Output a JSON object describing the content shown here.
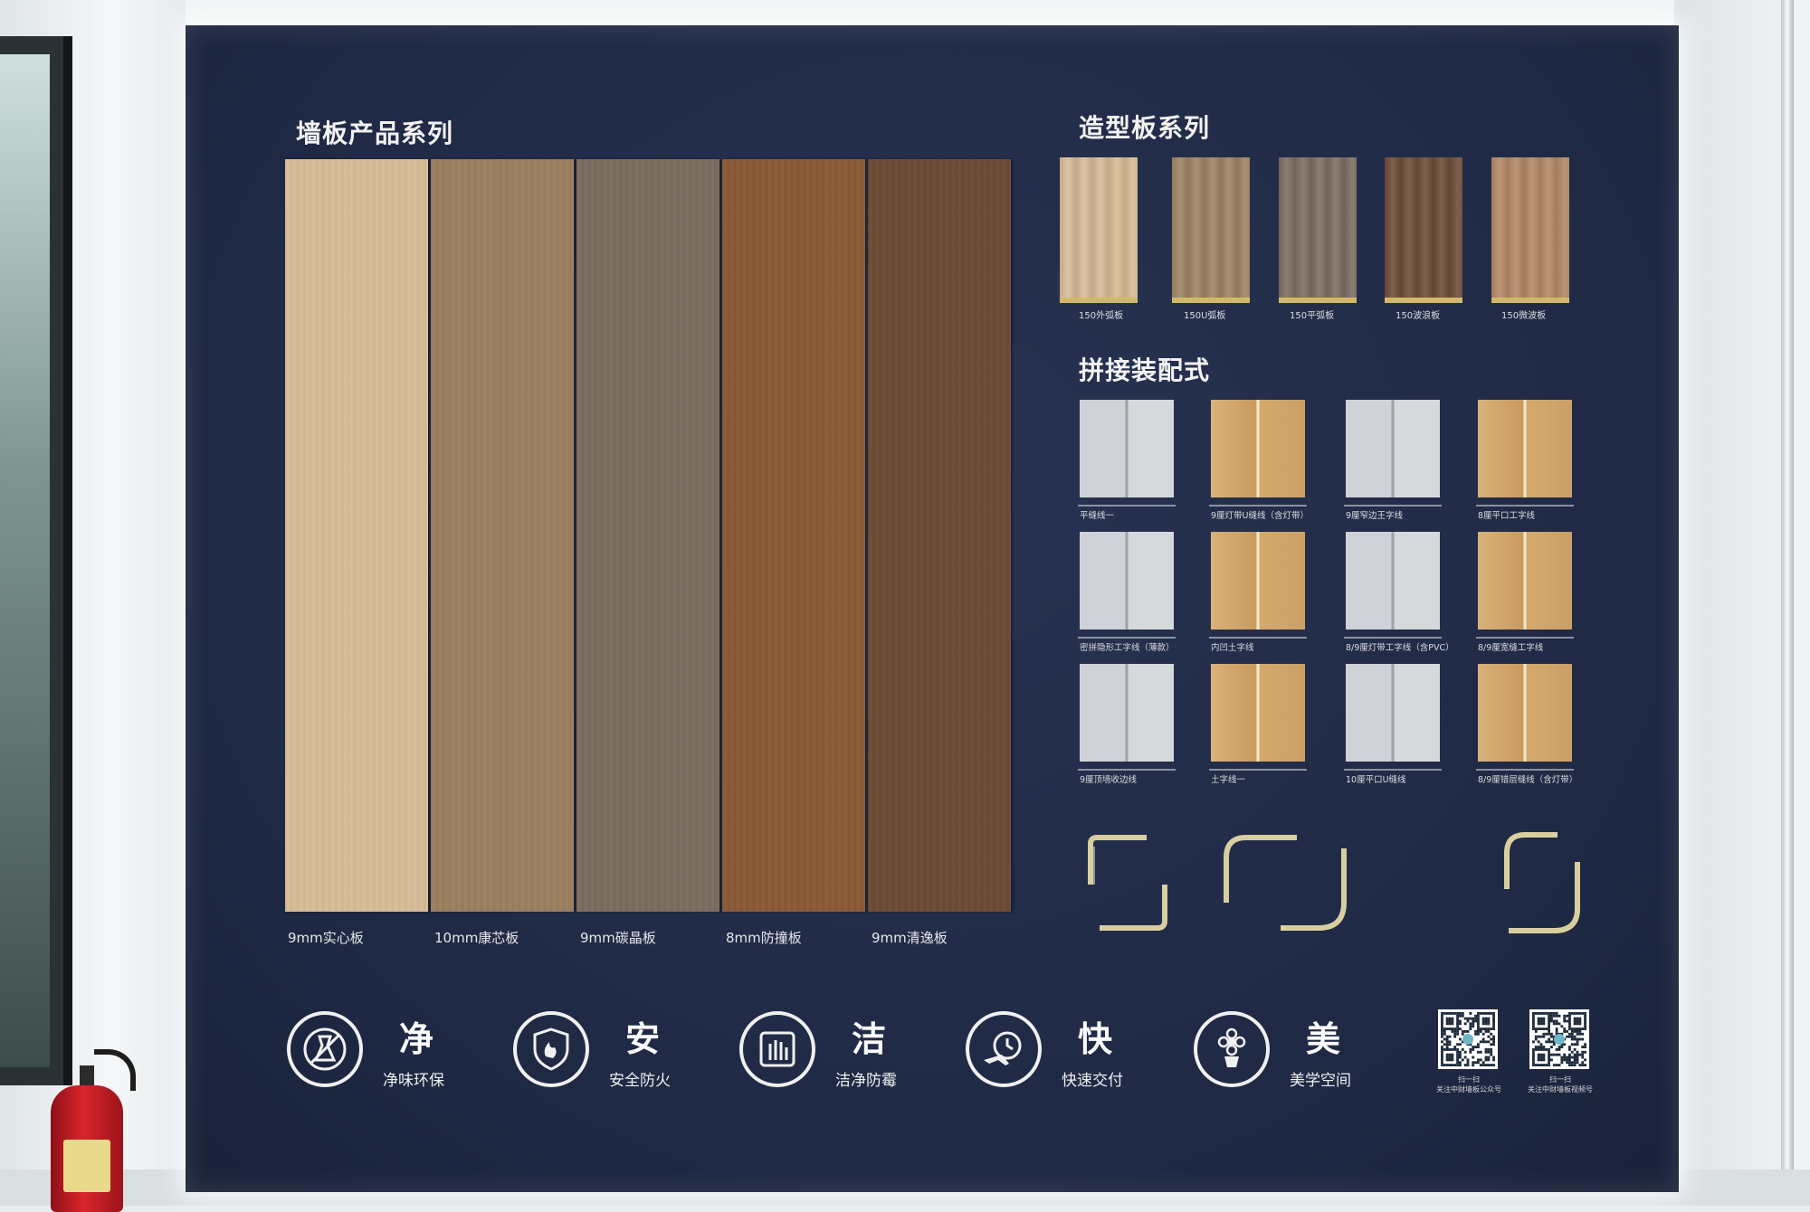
{
  "wall_panels": {
    "title": "墙板产品系列",
    "items": [
      {
        "label": "9mm实心板",
        "color": "#d8bd98"
      },
      {
        "label": "10mm康芯板",
        "color": "#9c7f5f"
      },
      {
        "label": "9mm碳晶板",
        "color": "#7a6c5e"
      },
      {
        "label": "8mm防撞板",
        "color": "#8a5a36"
      },
      {
        "label": "9mm清逸板",
        "color": "#6b4a33"
      }
    ]
  },
  "molding_panels": {
    "title": "造型板系列",
    "items": [
      {
        "label": "150外弧板",
        "color": "#d8bd98"
      },
      {
        "label": "150U弧板",
        "color": "#a08566"
      },
      {
        "label": "150平弧板",
        "color": "#7f6f62"
      },
      {
        "label": "150波浪板",
        "color": "#6e4f39"
      },
      {
        "label": "150微波板",
        "color": "#b48a68"
      }
    ]
  },
  "joint_styles": {
    "title": "拼接装配式",
    "items": [
      {
        "label": "平缝线一",
        "finish": "grey"
      },
      {
        "label": "9厘灯带U缝线（含灯带）",
        "finish": "wood"
      },
      {
        "label": "9厘窄边王字线",
        "finish": "grey"
      },
      {
        "label": "8厘平口工字线",
        "finish": "wood"
      },
      {
        "label": "密拼隐形工字线（薄款）",
        "finish": "grey"
      },
      {
        "label": "内凹土字线",
        "finish": "wood"
      },
      {
        "label": "8/9厘灯带工字线（含PVC）",
        "finish": "grey"
      },
      {
        "label": "8/9厘宽缝工字线",
        "finish": "wood"
      },
      {
        "label": "9厘顶墙收边线",
        "finish": "grey"
      },
      {
        "label": "土字线一",
        "finish": "wood"
      },
      {
        "label": "10厘平口U缝线",
        "finish": "grey"
      },
      {
        "label": "8/9厘错层缝线（含灯带）",
        "finish": "wood"
      }
    ]
  },
  "features": [
    {
      "char": "净",
      "text": "净味环保",
      "icon": "no-odor-icon"
    },
    {
      "char": "安",
      "text": "安全防火",
      "icon": "fire-shield-icon"
    },
    {
      "char": "洁",
      "text": "洁净防霉",
      "icon": "hand-wipe-icon"
    },
    {
      "char": "快",
      "text": "快速交付",
      "icon": "airplane-clock-icon"
    },
    {
      "char": "美",
      "text": "美学空间",
      "icon": "flower-pot-icon"
    }
  ],
  "qr_codes": [
    {
      "caption_line1": "扫一扫",
      "caption_line2": "关注中财墙板公众号"
    },
    {
      "caption_line1": "扫一扫",
      "caption_line2": "关注中财墙板视频号"
    }
  ]
}
